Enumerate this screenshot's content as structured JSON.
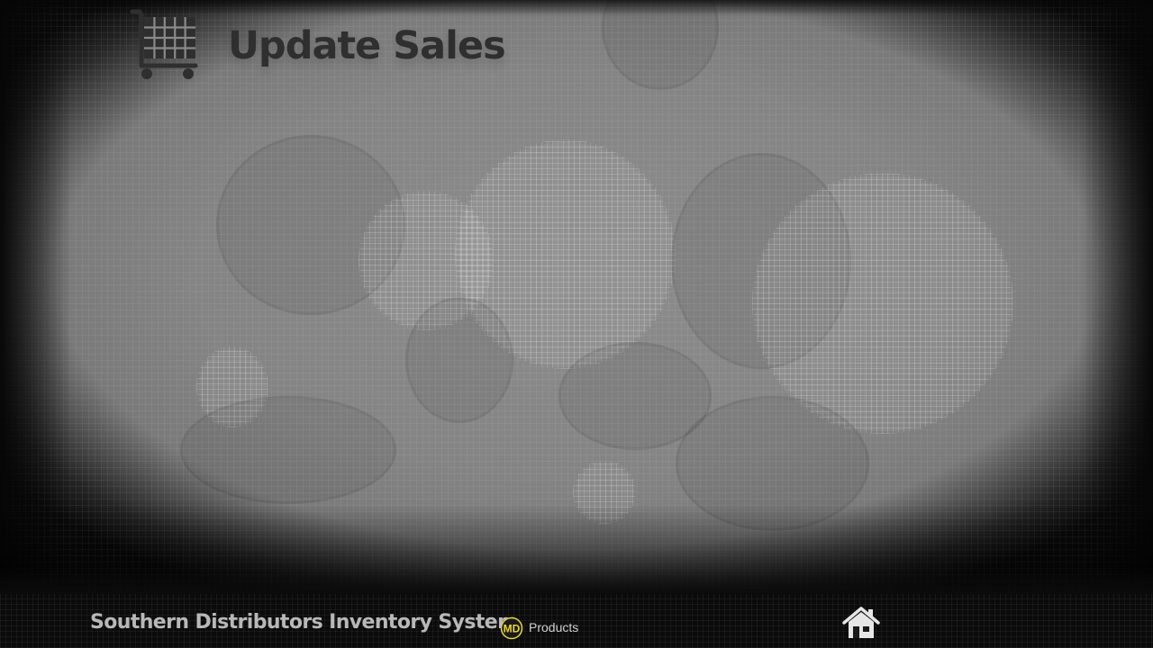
{
  "header": {
    "title": "Update Sales",
    "icon": "shopping-cart-icon"
  },
  "footer": {
    "system_name": "Southern Distributors Inventory System",
    "logo_text": "MD",
    "products_label": "Products",
    "home_icon": "home-icon"
  },
  "colors": {
    "title": "#2f2f2f",
    "footer_text": "#b8b8b8",
    "logo_yellow": "#e8d63a"
  }
}
